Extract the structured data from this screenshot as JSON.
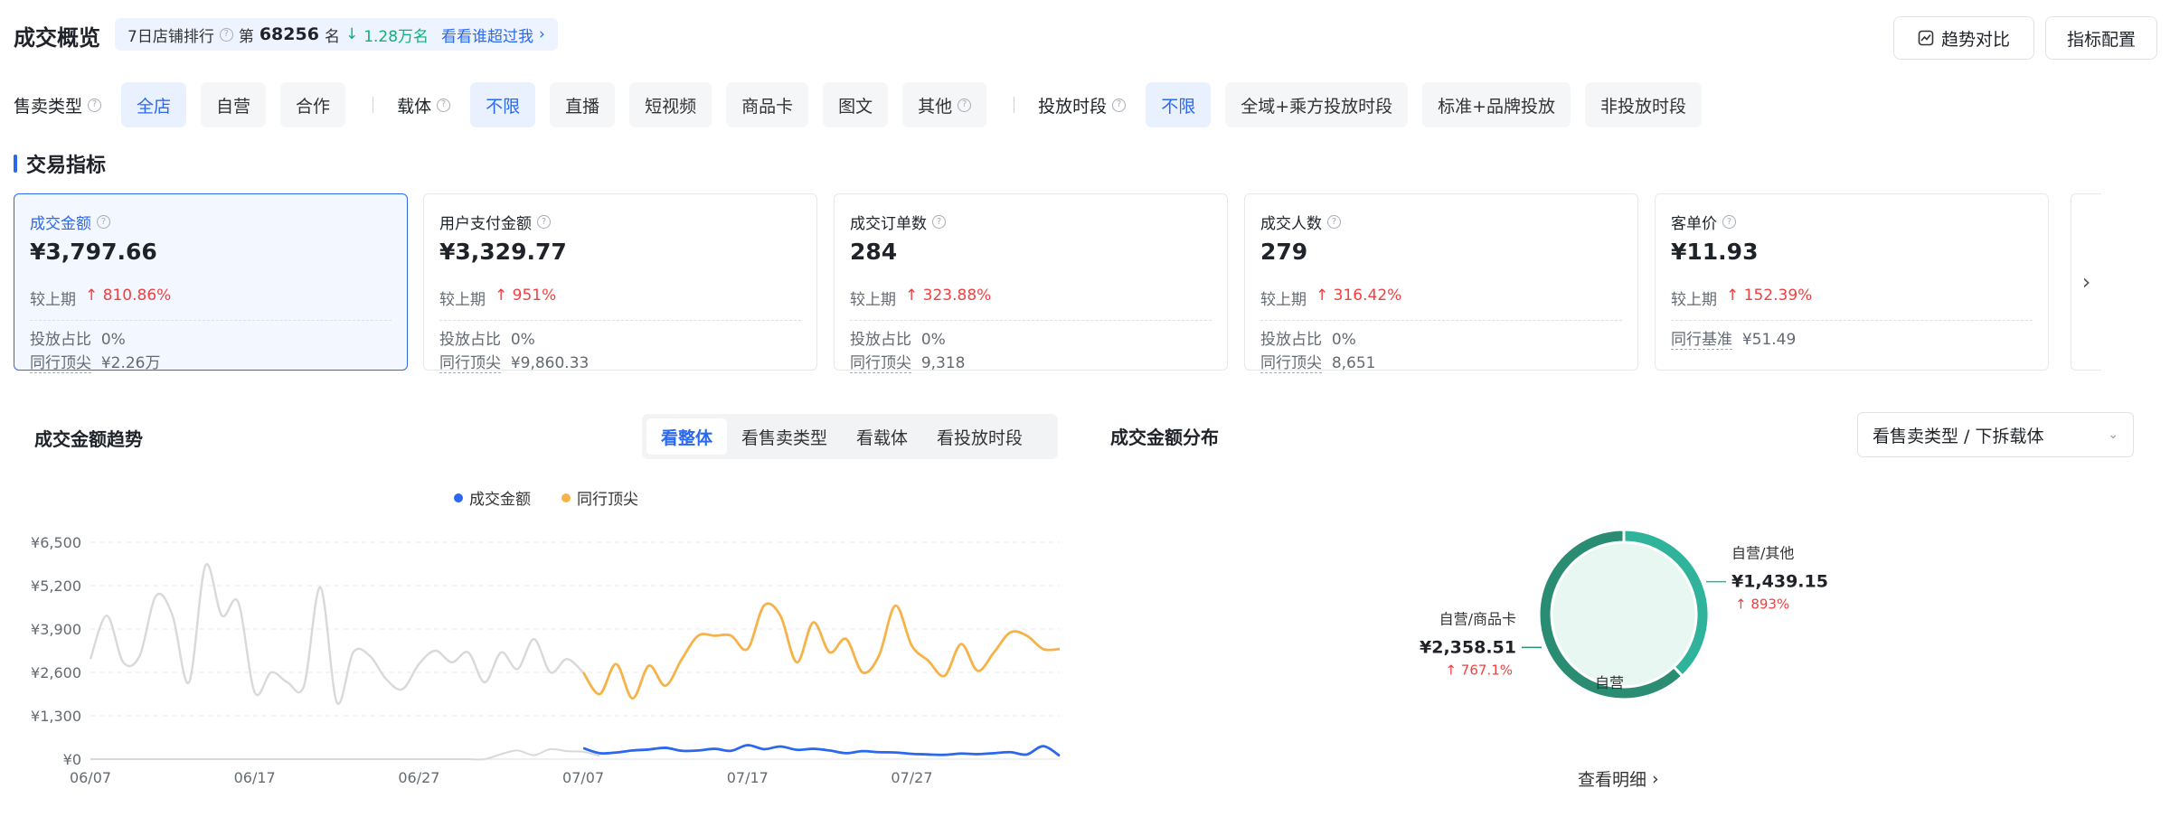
{
  "header": {
    "title": "成交概览",
    "rank_label": "7日店铺排行",
    "rank_prefix": "第",
    "rank_num": "68256",
    "rank_suffix": "名",
    "rank_change": "1.28万名",
    "rank_link": "看看谁超过我",
    "trend_btn": "趋势对比",
    "config_btn": "指标配置"
  },
  "filters": {
    "sale_type": {
      "label": "售卖类型",
      "options": [
        "全店",
        "自营",
        "合作"
      ],
      "active": 0
    },
    "carrier": {
      "label": "载体",
      "options": [
        "不限",
        "直播",
        "短视频",
        "商品卡",
        "图文",
        "其他"
      ],
      "active": 0
    },
    "period": {
      "label": "投放时段",
      "options": [
        "不限",
        "全域+乘方投放时段",
        "标准+品牌投放",
        "非投放时段"
      ],
      "active": 0
    }
  },
  "section": {
    "title": "交易指标"
  },
  "cards": [
    {
      "title": "成交金额",
      "value": "¥3,797.66",
      "compare_label": "较上期",
      "compare": "810.86%",
      "l1": "投放占比",
      "v1": "0%",
      "l2": "同行顶尖",
      "v2": "¥2.26万"
    },
    {
      "title": "用户支付金额",
      "value": "¥3,329.77",
      "compare_label": "较上期",
      "compare": "951%",
      "l1": "投放占比",
      "v1": "0%",
      "l2": "同行顶尖",
      "v2": "¥9,860.33"
    },
    {
      "title": "成交订单数",
      "value": "284",
      "compare_label": "较上期",
      "compare": "323.88%",
      "l1": "投放占比",
      "v1": "0%",
      "l2": "同行顶尖",
      "v2": "9,318"
    },
    {
      "title": "成交人数",
      "value": "279",
      "compare_label": "较上期",
      "compare": "316.42%",
      "l1": "投放占比",
      "v1": "0%",
      "l2": "同行顶尖",
      "v2": "8,651"
    },
    {
      "title": "客单价",
      "value": "¥11.93",
      "compare_label": "较上期",
      "compare": "152.39%",
      "l1": "同行基准",
      "v1": "¥51.49"
    }
  ],
  "trend": {
    "title": "成交金额趋势",
    "tabs": [
      "看整体",
      "看售卖类型",
      "看载体",
      "看投放时段"
    ],
    "active_tab": 0
  },
  "distribution": {
    "title": "成交金额分布",
    "select": "看售卖类型 / 下拆载体",
    "view_detail": "查看明细"
  },
  "colors": {
    "accent": "#2a68f0",
    "up_red": "#f04142",
    "up_green": "#10b07b",
    "peer": "#f5b34a",
    "donut_dark": "#2b8c74",
    "donut_light": "#2fb39a"
  },
  "chart_data": [
    {
      "type": "line",
      "title": "",
      "legend": [
        "成交金额",
        "同行顶尖"
      ],
      "legend_position": "top-center",
      "y_ticks": [
        "¥6,500",
        "¥5,200",
        "¥3,900",
        "¥2,600",
        "¥1,300",
        "¥0"
      ],
      "ylim": [
        0,
        6500
      ],
      "x_ticks": [
        "06/07",
        "06/17",
        "06/27",
        "07/07",
        "07/17",
        "07/27"
      ],
      "x": [
        "06/07",
        "06/08",
        "06/09",
        "06/10",
        "06/11",
        "06/12",
        "06/13",
        "06/14",
        "06/15",
        "06/16",
        "06/17",
        "06/18",
        "06/19",
        "06/20",
        "06/21",
        "06/22",
        "06/23",
        "06/24",
        "06/25",
        "06/26",
        "06/27",
        "06/28",
        "06/29",
        "06/30",
        "07/01",
        "07/02",
        "07/03",
        "07/04",
        "07/05",
        "07/06",
        "07/07",
        "07/08",
        "07/09",
        "07/10",
        "07/11",
        "07/12",
        "07/13",
        "07/14",
        "07/15",
        "07/16",
        "07/17",
        "07/18",
        "07/19",
        "07/20",
        "07/21",
        "07/22",
        "07/23",
        "07/24",
        "07/25",
        "07/26",
        "07/27",
        "07/28",
        "07/29",
        "07/30",
        "07/31",
        "08/01",
        "08/02",
        "08/03",
        "08/04",
        "08/05"
      ],
      "series": [
        {
          "name": "成交金额",
          "color": "#2a68f0",
          "values": [
            0,
            0,
            0,
            0,
            0,
            0,
            0,
            0,
            0,
            0,
            0,
            0,
            0,
            0,
            0,
            0,
            0,
            0,
            0,
            0,
            0,
            0,
            0,
            0,
            0,
            0,
            0,
            0,
            0,
            0,
            330,
            180,
            200,
            260,
            290,
            340,
            250,
            260,
            310,
            250,
            420,
            300,
            380,
            280,
            310,
            260,
            180,
            240,
            210,
            200,
            160,
            140,
            130,
            170,
            150,
            180,
            210,
            140,
            390,
            100
          ]
        },
        {
          "name": "同行顶尖",
          "color": "#f5b34a",
          "values": [
            3000,
            4300,
            2900,
            3100,
            4900,
            4300,
            2300,
            5800,
            4300,
            4700,
            2000,
            2600,
            2300,
            2200,
            5150,
            1700,
            3200,
            3100,
            2400,
            2100,
            2850,
            3250,
            2900,
            3200,
            2300,
            3200,
            2700,
            3600,
            2600,
            3000,
            2600,
            1950,
            2850,
            1820,
            2800,
            2200,
            3000,
            3700,
            3700,
            3700,
            3300,
            4600,
            4300,
            2900,
            4100,
            3200,
            3600,
            2600,
            3100,
            4600,
            3400,
            2950,
            2500,
            3450,
            2650,
            3200,
            3800,
            3700,
            3300,
            3300
          ]
        },
        {
          "name": "",
          "color": "#d9d9d9",
          "values": [
            0,
            0,
            0,
            0,
            0,
            0,
            0,
            0,
            0,
            0,
            0,
            0,
            0,
            0,
            0,
            0,
            0,
            0,
            0,
            0,
            0,
            0,
            0,
            0,
            0,
            150,
            260,
            120,
            300,
            240,
            220,
            100
          ]
        }
      ]
    },
    {
      "type": "pie",
      "title": "",
      "center_label": "自营",
      "slices": [
        {
          "label": "自营/其他",
          "value": 1439.15,
          "display": "¥1,439.15",
          "change": "893%",
          "color": "#2fb39a"
        },
        {
          "label": "自营/商品卡",
          "value": 2358.51,
          "display": "¥2,358.51",
          "change": "767.1%",
          "color": "#2b8c74"
        }
      ]
    }
  ]
}
